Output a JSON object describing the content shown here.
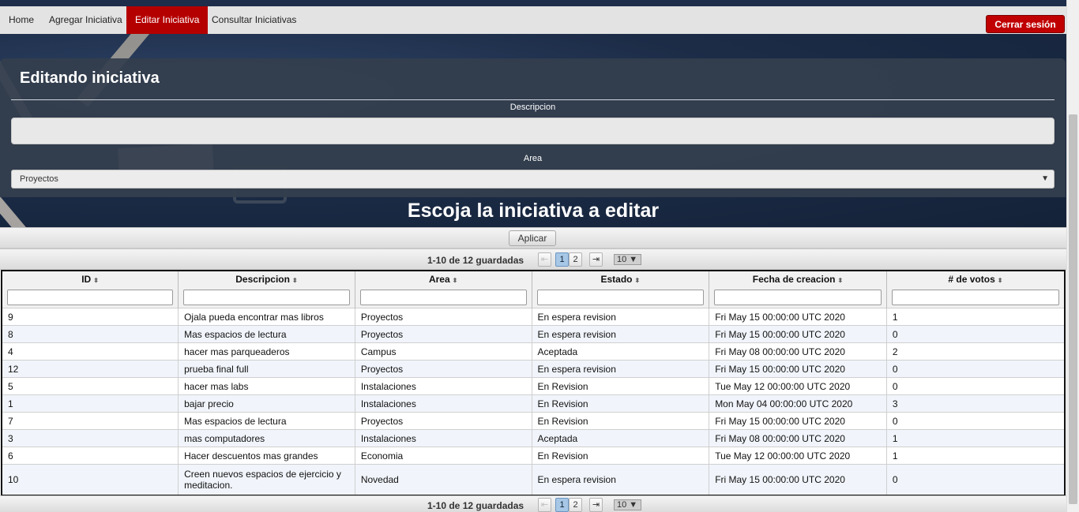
{
  "nav": {
    "items": [
      {
        "label": "Home"
      },
      {
        "label": "Agregar Iniciativa"
      },
      {
        "label": "Editar Iniciativa"
      },
      {
        "label": "Consultar Iniciativas"
      }
    ],
    "active_index": 2,
    "logout_label": "Cerrar sesión"
  },
  "edit_panel": {
    "title": "Editando iniciativa",
    "descripcion_label": "Descripcion",
    "descripcion_value": "",
    "area_label": "Area",
    "area_value": "Proyectos"
  },
  "choose_title": "Escoja la iniciativa a editar",
  "apply_label": "Aplicar",
  "pager": {
    "count_text": "1-10 de 12 guardadas",
    "pages": [
      "1",
      "2"
    ],
    "current_page": "1",
    "rows_per_page": "10"
  },
  "table": {
    "columns": [
      "ID",
      "Descripcion",
      "Area",
      "Estado",
      "Fecha de creacion",
      "# de votos"
    ],
    "rows": [
      [
        "9",
        "Ojala pueda encontrar mas libros",
        "Proyectos",
        "En espera revision",
        "Fri May 15 00:00:00 UTC 2020",
        "1"
      ],
      [
        "8",
        "Mas espacios de lectura",
        "Proyectos",
        "En espera revision",
        "Fri May 15 00:00:00 UTC 2020",
        "0"
      ],
      [
        "4",
        "hacer mas parqueaderos",
        "Campus",
        "Aceptada",
        "Fri May 08 00:00:00 UTC 2020",
        "2"
      ],
      [
        "12",
        "prueba final full",
        "Proyectos",
        "En espera revision",
        "Fri May 15 00:00:00 UTC 2020",
        "0"
      ],
      [
        "5",
        "hacer mas labs",
        "Instalaciones",
        "En Revision",
        "Tue May 12 00:00:00 UTC 2020",
        "0"
      ],
      [
        "1",
        "bajar precio",
        "Instalaciones",
        "En Revision",
        "Mon May 04 00:00:00 UTC 2020",
        "3"
      ],
      [
        "7",
        "Mas espacios de lectura",
        "Proyectos",
        "En Revision",
        "Fri May 15 00:00:00 UTC 2020",
        "0"
      ],
      [
        "3",
        "mas computadores",
        "Instalaciones",
        "Aceptada",
        "Fri May 08 00:00:00 UTC 2020",
        "1"
      ],
      [
        "6",
        "Hacer descuentos mas grandes",
        "Economia",
        "En Revision",
        "Tue May 12 00:00:00 UTC 2020",
        "1"
      ],
      [
        "10",
        "Creen nuevos espacios de ejercicio y meditacion.",
        "Novedad",
        "En espera revision",
        "Fri May 15 00:00:00 UTC 2020",
        "0"
      ]
    ]
  },
  "colors": {
    "nav_active": "#b50000",
    "logout": "#c00000",
    "panel": "#343e4e",
    "page_active": "#a7c7e6"
  }
}
